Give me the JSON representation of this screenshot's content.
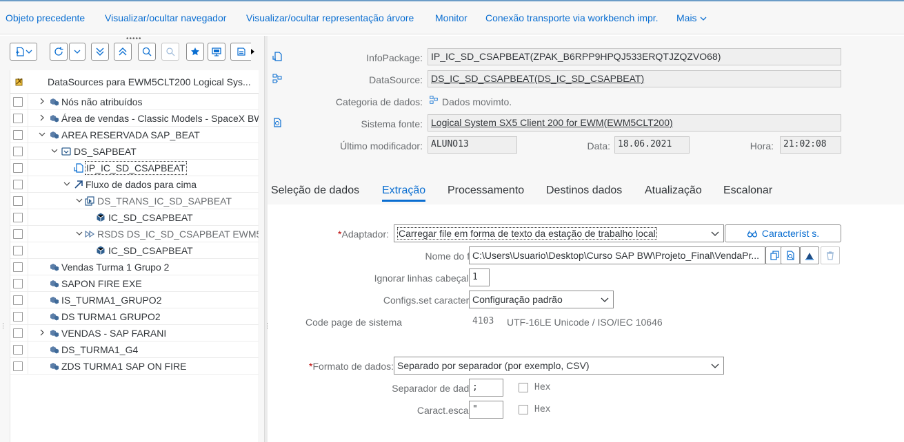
{
  "toolbar": {
    "items": [
      "Objeto precedente",
      "Visualizar/ocultar navegador",
      "Visualizar/ocultar representação árvore",
      "Monitor",
      "Conexão transporte via workbench impr.",
      "Mais"
    ]
  },
  "tree": {
    "header": "DataSources para EWM5CLT200 Logical Sys...",
    "rows": [
      {
        "label": "Nós não atribuídos"
      },
      {
        "label": "Área de vendas - Classic Models - SpaceX BW"
      },
      {
        "label": "AREA RESERVADA SAP_BEAT"
      },
      {
        "label": "DS_SAPBEAT"
      },
      {
        "label": "IP_IC_SD_CSAPBEAT"
      },
      {
        "label": "Fluxo de dados para cima"
      },
      {
        "label": "DS_TRANS_IC_SD_SAPBEAT"
      },
      {
        "label": "IC_SD_CSAPBEAT"
      },
      {
        "label": "RSDS DS_IC_SD_CSAPBEAT EWM5"
      },
      {
        "label": "IC_SD_CSAPBEAT"
      },
      {
        "label": "Vendas Turma 1 Grupo 2"
      },
      {
        "label": "SAPON  FIRE EXE"
      },
      {
        "label": "IS_TURMA1_GRUPO2"
      },
      {
        "label": "DS TURMA1 GRUPO2"
      },
      {
        "label": "VENDAS - SAP FARANI"
      },
      {
        "label": "DS_TURMA1_G4"
      },
      {
        "label": "ZDS TURMA1 SAP ON FIRE"
      }
    ]
  },
  "header": {
    "infopackage_label": "InfoPackage:",
    "infopackage_value": "IP_IC_SD_CSAPBEAT(ZPAK_B6RPP9HPQJ533ERQTJZQZVO68)",
    "datasource_label": "DataSource:",
    "datasource_value": "DS_IC_SD_CSAPBEAT(DS_IC_SD_CSAPBEAT)",
    "categoria_label": "Categoria de dados:",
    "categoria_value": "Dados movimto.",
    "sistema_label": "Sistema fonte:",
    "sistema_value": "Logical System SX5 Client 200 for EWM(EWM5CLT200)",
    "modificador_label": "Último modificador:",
    "modificador_value": "ALUNO13",
    "data_label": "Data:",
    "data_value": "18.06.2021",
    "hora_label": "Hora:",
    "hora_value": "21:02:08"
  },
  "tabs": [
    "Seleção de dados",
    "Extração",
    "Processamento",
    "Destinos dados",
    "Atualização",
    "Escalonar"
  ],
  "active_tab": "Extração",
  "form": {
    "adaptador_label": "Adaptador:",
    "adaptador_value": "Carregar file em forma de texto da estação de trabalho local",
    "caracterists_label": "Característ s.",
    "nome_label": "Nome do file:",
    "nome_value": "C:\\Users\\Usuario\\Desktop\\Curso SAP BW\\Projeto_Final\\VendaPr...",
    "ignorar_label": "Ignorar linhas cabeçalho:",
    "ignorar_value": "1",
    "configs_label": "Configs.set caracteres:",
    "configs_value": "Configuração padrão",
    "codepage_label": "Code page de sistema",
    "codepage_num": "4103",
    "codepage_desc": "UTF-16LE Unicode / ISO/IEC 10646",
    "formato_label": "Formato de dados:",
    "formato_value": "Separado por separador (por exemplo, CSV)",
    "separador_label": "Separador de dados:",
    "separador_value": ";",
    "separador_hex": "Hex",
    "escape_label": "Caract.escape:",
    "escape_value": "\"",
    "escape_hex": "Hex"
  },
  "colors": {
    "accent": "#0a6ed1",
    "required": "#bb0000"
  }
}
